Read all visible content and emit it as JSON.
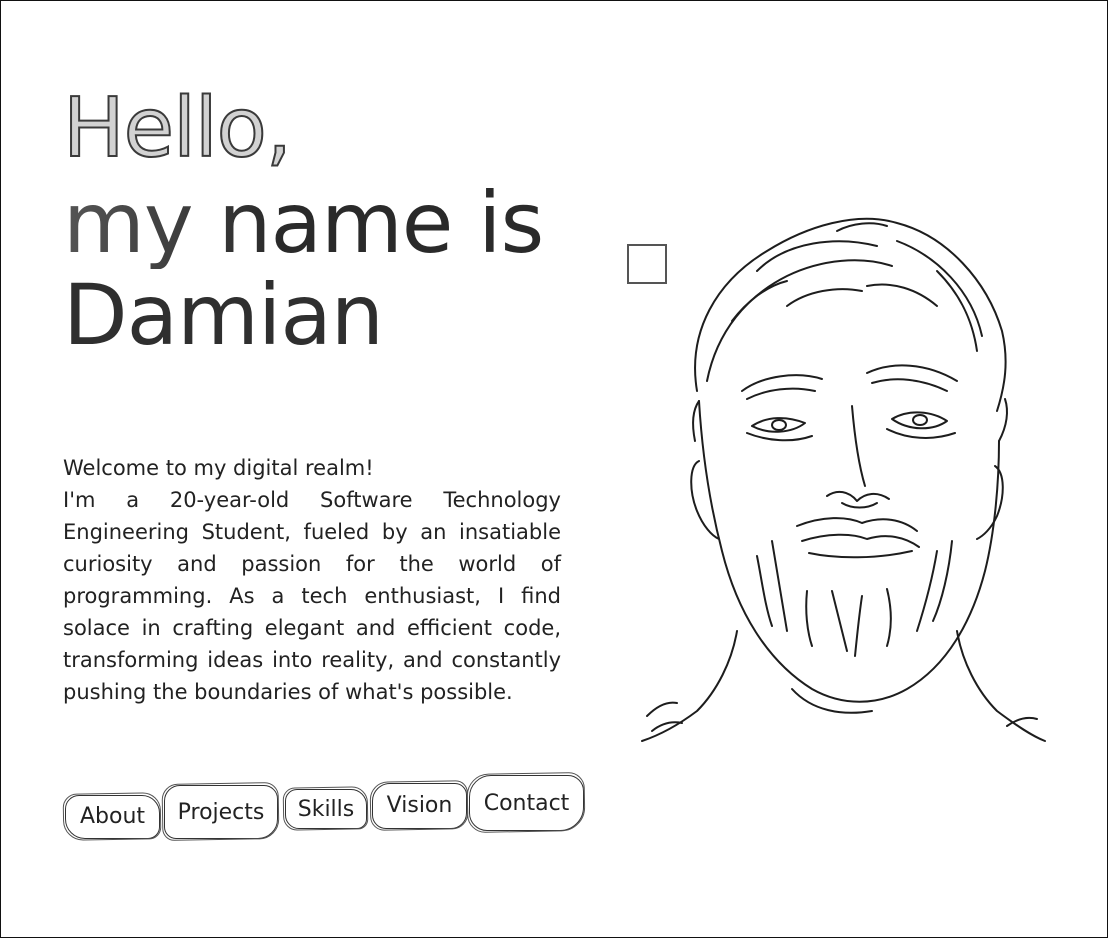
{
  "hero": {
    "greeting": "Hello,",
    "line1": "my name is",
    "line2": "Damian"
  },
  "intro": {
    "welcome": "Welcome to my digital realm!",
    "bio": "I'm a 20-year-old Software Technology Engineering Student, fueled by an insatiable curiosity and passion for the world of programming. As a tech enthusiast, I find solace in crafting elegant and efficient code, transforming ideas into reality, and constantly pushing the boundaries of what's possible."
  },
  "nav": {
    "about": "About",
    "projects": "Projects",
    "skills": "Skills",
    "vision": "Vision",
    "contact": "Contact"
  },
  "icons": {
    "square": "square-icon",
    "portrait": "portrait-sketch-icon"
  }
}
